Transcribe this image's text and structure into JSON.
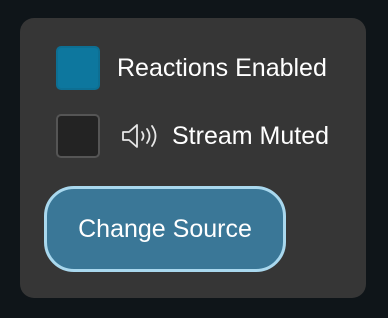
{
  "controls": {
    "reactions": {
      "label": "Reactions Enabled",
      "checked": true,
      "color": "#0d779e"
    },
    "stream_muted": {
      "label": "Stream Muted",
      "checked": false,
      "icon": "speaker-icon"
    },
    "change_source_button": {
      "label": "Change Source",
      "color": "#3a7797"
    }
  }
}
